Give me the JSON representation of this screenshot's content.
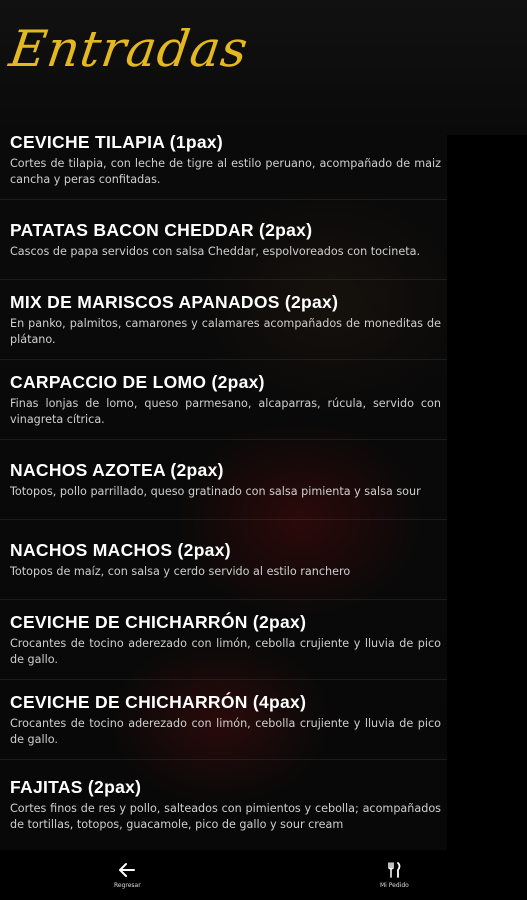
{
  "header": {
    "title": "Entradas"
  },
  "items": [
    {
      "name": "CEVICHE TILAPIA (1pax)",
      "desc": "Cortes de tilapia, con leche de tigre al estilo peruano, acompañado de maiz cancha y peras confitadas."
    },
    {
      "name": "PATATAS BACON CHEDDAR (2pax)",
      "desc": "Cascos de papa servidos con salsa Cheddar, espolvoreados con tocineta."
    },
    {
      "name": "MIX DE MARISCOS APANADOS (2pax)",
      "desc": "En panko, palmitos, camarones y calamares acompañados de moneditas de plátano."
    },
    {
      "name": "CARPACCIO DE LOMO (2pax)",
      "desc": "Finas lonjas de lomo, queso parmesano, alcaparras, rúcula, servido con vinagreta cítrica."
    },
    {
      "name": "NACHOS AZOTEA (2pax)",
      "desc": "Totopos, pollo parrillado, queso gratinado con salsa pimienta y salsa sour"
    },
    {
      "name": "NACHOS MACHOS (2pax)",
      "desc": "Totopos de maíz, con salsa y cerdo servido al estilo ranchero"
    },
    {
      "name": "CEVICHE DE CHICHARRÓN (2pax)",
      "desc": "Crocantes de tocino aderezado con limón, cebolla crujiente y lluvia de pico de gallo."
    },
    {
      "name": "CEVICHE DE CHICHARRÓN (4pax)",
      "desc": "Crocantes de tocino aderezado con limón, cebolla crujiente y lluvia de pico de gallo."
    },
    {
      "name": "FAJITAS (2pax)",
      "desc": "Cortes finos de res y pollo, salteados con pimientos y cebolla; acompañados de tortillas, totopos, guacamole, pico de gallo y sour cream"
    }
  ],
  "nav": {
    "back_label": "Regresar",
    "back_icon": "arrow-left-icon",
    "order_label": "Mi Pedido",
    "order_icon": "fork-knife-icon"
  },
  "colors": {
    "title": "#e3b820",
    "background": "#050505",
    "text": "#ffffff",
    "desc": "#cfcfcf"
  }
}
